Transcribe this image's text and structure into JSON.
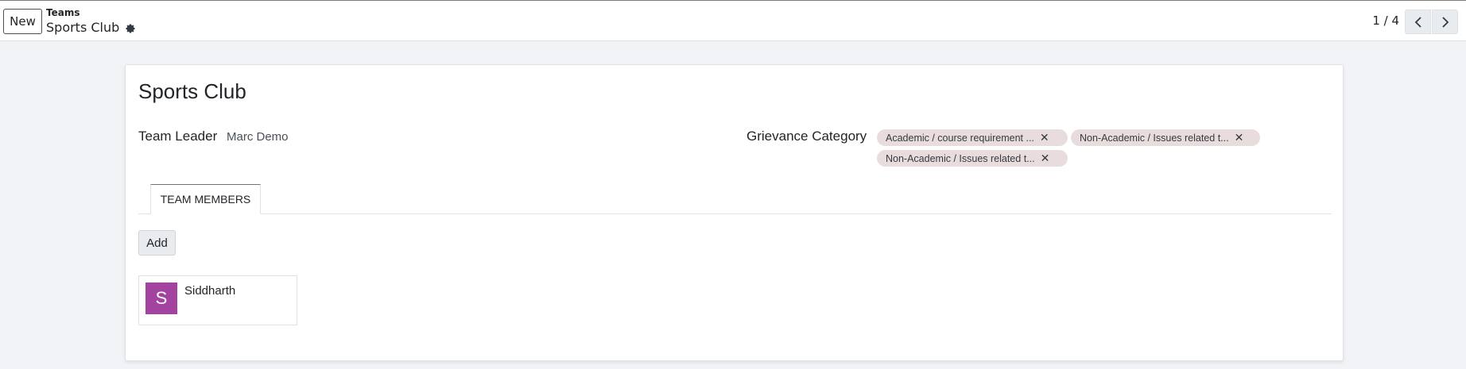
{
  "control_panel": {
    "new_label": "New",
    "breadcrumb_parent": "Teams",
    "breadcrumb_current": "Sports Club",
    "pager_value": "1 / 4"
  },
  "form": {
    "title": "Sports Club",
    "team_leader_label": "Team Leader",
    "team_leader_value": "Marc Demo",
    "grievance_category_label": "Grievance Category",
    "grievance_tags": [
      "Academic / course requirement ...",
      "Non-Academic / Issues related t...",
      "Non-Academic / Issues related t..."
    ],
    "tag_color": "#e9dcdd"
  },
  "notebook": {
    "tabs": [
      "TEAM MEMBERS"
    ],
    "add_label": "Add",
    "members": [
      {
        "initial": "S",
        "name": "Siddharth",
        "avatar_color": "#a2449f"
      }
    ]
  }
}
